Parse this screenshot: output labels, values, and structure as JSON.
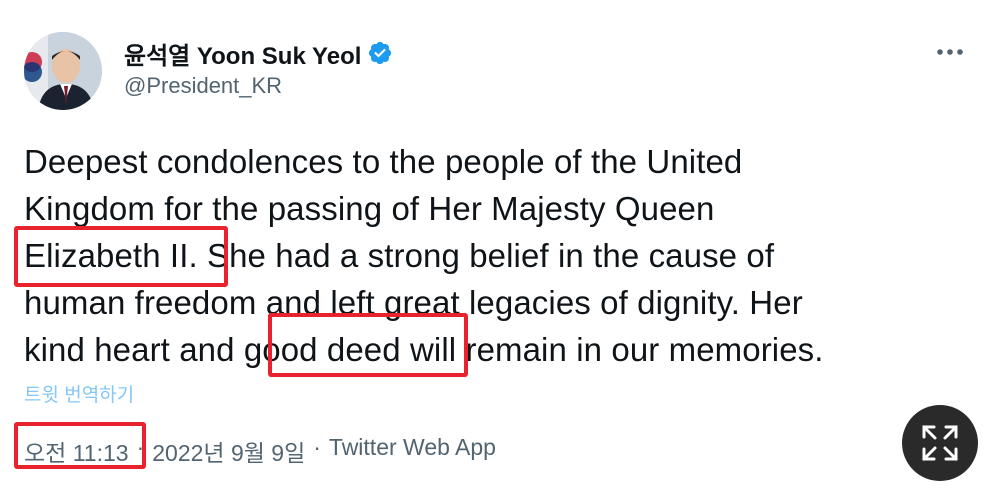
{
  "tweet": {
    "display_name": "윤석열 Yoon Suk Yeol",
    "handle": "@President_KR",
    "lines": [
      "Deepest condolences to the people of the United",
      "Kingdom for the passing of Her Majesty Queen",
      "Elizabeth II. She had a strong belief in the cause of",
      "human freedom and left great legacies of dignity. Her",
      "kind heart and good deed will remain in our memories."
    ],
    "translate_label": "트윗 번역하기",
    "time": "오전 11:13",
    "separator": "·",
    "date": "2022년 9월 9일",
    "source": "Twitter Web App"
  },
  "icons": {
    "verified": "verified-badge-icon",
    "more": "more-dots-icon",
    "expand": "expand-arrows-icon"
  },
  "colors": {
    "text": "#0f1419",
    "secondary": "#536471",
    "link": "#1d9bf0",
    "highlight": "#e8232d",
    "expand_button": "#2a2a2a"
  }
}
